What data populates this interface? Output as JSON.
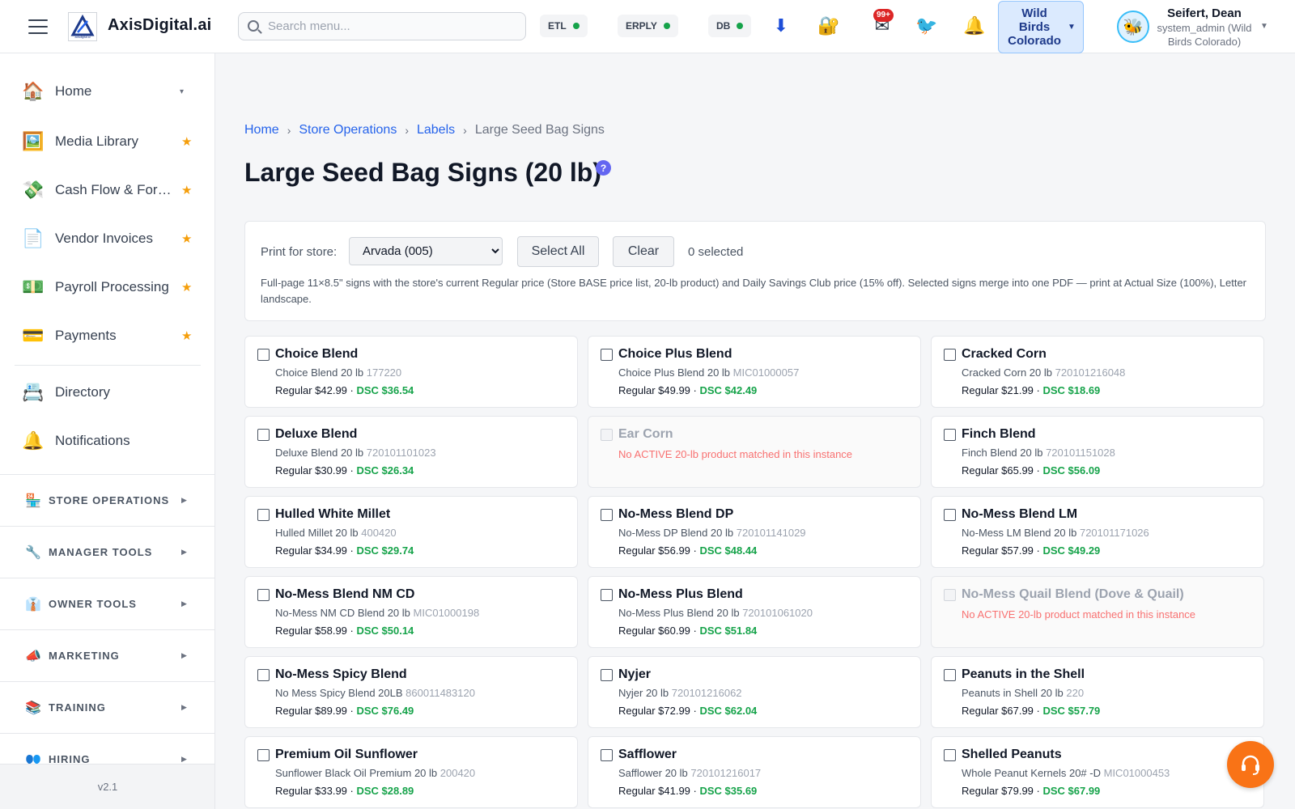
{
  "header": {
    "logo_text": "AxisDigital.ai",
    "logo_small": "axisdigital.ai",
    "search_placeholder": "Search menu...",
    "status": [
      {
        "label": "ETL",
        "color": "#16a34a"
      },
      {
        "label": "ERPLY",
        "color": "#16a34a"
      },
      {
        "label": "DB",
        "color": "#16a34a"
      }
    ],
    "icons": {
      "download": "⬇",
      "lock": "🔐",
      "mail": "✉",
      "bird": "🐦",
      "bell": "🔔"
    },
    "mail_badge": "99+",
    "store_switcher": "Wild\nBirds\nColorado",
    "user_avatar": "🐝",
    "user_name": "Seifert, Dean",
    "user_role": "system_admin (Wild Birds Colorado)"
  },
  "sidebar": {
    "items": [
      {
        "icon": "🏠",
        "label": "Home",
        "marker": "▾"
      },
      {
        "icon": "🖼️",
        "label": "Media Library",
        "marker": "★"
      },
      {
        "icon": "💸",
        "label": "Cash Flow & For…",
        "marker": "★"
      },
      {
        "icon": "📄",
        "label": "Vendor Invoices",
        "marker": "★"
      },
      {
        "icon": "💵",
        "label": "Payroll Processing",
        "marker": "★"
      },
      {
        "icon": "💳",
        "label": "Payments",
        "marker": "★"
      },
      {
        "icon": "📇",
        "label": "Directory",
        "marker": ""
      },
      {
        "icon": "🔔",
        "label": "Notifications",
        "marker": ""
      }
    ],
    "sections": [
      {
        "icon": "🏪",
        "label": "STORE OPERATIONS"
      },
      {
        "icon": "🔧",
        "label": "MANAGER TOOLS"
      },
      {
        "icon": "👔",
        "label": "OWNER TOOLS"
      },
      {
        "icon": "📣",
        "label": "MARKETING"
      },
      {
        "icon": "📚",
        "label": "TRAINING"
      },
      {
        "icon": "👥",
        "label": "HIRING"
      }
    ],
    "version": "v2.1"
  },
  "breadcrumb": {
    "items": [
      "Home",
      "Store Operations",
      "Labels"
    ],
    "current": "Large Seed Bag Signs"
  },
  "page": {
    "title": "Large Seed Bag Signs (20 lb)",
    "help": "?"
  },
  "controls": {
    "print_label": "Print for store:",
    "store_selected": "Arvada (005)",
    "select_all": "Select All",
    "clear": "Clear",
    "selected_count": "0 selected",
    "description": "Full-page 11×8.5\" signs with the store's current Regular price (Store BASE price list, 20-lb product) and Daily Savings Club price (15% off). Selected signs merge into one PDF — print at Actual Size (100%), Letter landscape."
  },
  "cards": [
    {
      "name": "Choice Blend",
      "product": "Choice Blend 20 lb",
      "sku": "177220",
      "regular": "Regular $42.99",
      "dsc": "DSC $36.54"
    },
    {
      "name": "Choice Plus Blend",
      "product": "Choice Plus Blend 20 lb",
      "sku": "MIC01000057",
      "regular": "Regular $49.99",
      "dsc": "DSC $42.49"
    },
    {
      "name": "Cracked Corn",
      "product": "Cracked Corn 20 lb",
      "sku": "720101216048",
      "regular": "Regular $21.99",
      "dsc": "DSC $18.69"
    },
    {
      "name": "Deluxe Blend",
      "product": "Deluxe Blend 20 lb",
      "sku": "720101101023",
      "regular": "Regular $30.99",
      "dsc": "DSC $26.34"
    },
    {
      "name": "Ear Corn",
      "disabled": true,
      "warning": "No ACTIVE 20-lb product matched in this instance"
    },
    {
      "name": "Finch Blend",
      "product": "Finch Blend 20 lb",
      "sku": "720101151028",
      "regular": "Regular $65.99",
      "dsc": "DSC $56.09"
    },
    {
      "name": "Hulled White Millet",
      "product": "Hulled Millet 20 lb",
      "sku": "400420",
      "regular": "Regular $34.99",
      "dsc": "DSC $29.74"
    },
    {
      "name": "No-Mess Blend DP",
      "product": "No-Mess DP Blend 20 lb",
      "sku": "720101141029",
      "regular": "Regular $56.99",
      "dsc": "DSC $48.44"
    },
    {
      "name": "No-Mess Blend LM",
      "product": "No-Mess LM Blend 20 lb",
      "sku": "720101171026",
      "regular": "Regular $57.99",
      "dsc": "DSC $49.29"
    },
    {
      "name": "No-Mess Blend NM CD",
      "product": "No-Mess NM CD Blend 20 lb",
      "sku": "MIC01000198",
      "regular": "Regular $58.99",
      "dsc": "DSC $50.14"
    },
    {
      "name": "No-Mess Plus Blend",
      "product": "No-Mess Plus Blend 20 lb",
      "sku": "720101061020",
      "regular": "Regular $60.99",
      "dsc": "DSC $51.84"
    },
    {
      "name": "No-Mess Quail Blend (Dove & Quail)",
      "disabled": true,
      "warning": "No ACTIVE 20-lb product matched in this instance"
    },
    {
      "name": "No-Mess Spicy Blend",
      "product": "No Mess Spicy Blend 20LB",
      "sku": "860011483120",
      "regular": "Regular $89.99",
      "dsc": "DSC $76.49"
    },
    {
      "name": "Nyjer",
      "product": "Nyjer 20 lb",
      "sku": "720101216062",
      "regular": "Regular $72.99",
      "dsc": "DSC $62.04"
    },
    {
      "name": "Peanuts in the Shell",
      "product": "Peanuts in Shell 20 lb",
      "sku": "220",
      "regular": "Regular $67.99",
      "dsc": "DSC $57.79"
    },
    {
      "name": "Premium Oil Sunflower",
      "product": "Sunflower Black Oil Premium 20 lb",
      "sku": "200420",
      "regular": "Regular $33.99",
      "dsc": "DSC $28.89"
    },
    {
      "name": "Safflower",
      "product": "Safflower 20 lb",
      "sku": "720101216017",
      "regular": "Regular $41.99",
      "dsc": "DSC $35.69"
    },
    {
      "name": "Shelled Peanuts",
      "product": "Whole Peanut Kernels 20# -D",
      "sku": "MIC01000453",
      "regular": "Regular $79.99",
      "dsc": "DSC $67.99"
    }
  ],
  "support_icon": "headset-icon"
}
